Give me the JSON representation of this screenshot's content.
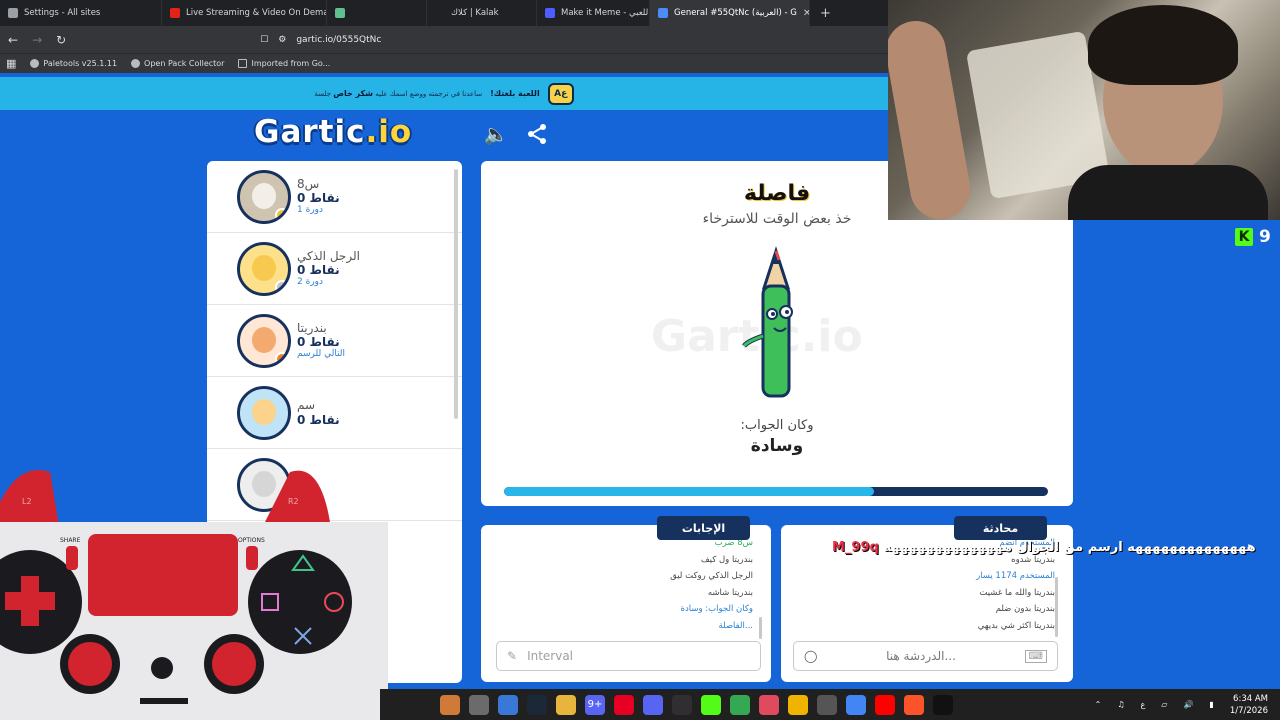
{
  "browser": {
    "tabs": [
      {
        "title": "Settings - All sites",
        "icon": "gear-icon",
        "color": "#9aa0a6"
      },
      {
        "title": "Live Streaming & Video On Demand",
        "icon": "video-icon",
        "color": "#e62117"
      },
      {
        "title": "",
        "icon": "app-icon",
        "color": "#5fbf8f"
      },
      {
        "title": "كلاك | Kalak",
        "icon": "",
        "color": "#202124"
      },
      {
        "title": "Make it Meme - دعوة للعبي",
        "icon": "meme-icon",
        "color": "#4e5dff"
      },
      {
        "title": "General #55QtNc (العربية) - G",
        "icon": "gartic-icon",
        "color": "#4b8cf7"
      }
    ],
    "new_tab": "+",
    "url": "gartic.io/0555QtNc",
    "bookmarks": [
      "Paletools v25.1.11",
      "Open Pack Collector",
      "Imported from Go..."
    ]
  },
  "banner": {
    "prefix": "ساعدنا في ترجمته ووضع اسمك عليه",
    "highlight": "شكر خاص",
    "suffix": "جلسة",
    "cta": "!اللعبة بلغتك"
  },
  "logo": {
    "main": "Gartic",
    "suffix": ".io"
  },
  "players": [
    {
      "name": "س8",
      "score": "0",
      "score_label": "نقاط",
      "turn": "دورة 1",
      "avatar_color": "#cfc4b0",
      "face_color": "#f3efe8",
      "dot_color": "#f2c42a"
    },
    {
      "name": "الرجل الذكي",
      "score": "0",
      "score_label": "نقاط",
      "turn": "دورة 2",
      "avatar_color": "#fde08a",
      "face_color": "#f7c94f",
      "dot_color": "#c5c5c5"
    },
    {
      "name": "بندريتا",
      "score": "0",
      "score_label": "نقاط",
      "turn": "التالي للرسم",
      "avatar_color": "#ffe7d5",
      "face_color": "#f4a96f",
      "dot_color": "#f07f2a"
    },
    {
      "name": "سم",
      "score": "0",
      "score_label": "نقاط",
      "turn": "",
      "avatar_color": "#bfe4f7",
      "face_color": "#fbd38b",
      "dot_color": ""
    },
    {
      "name": "",
      "score": "",
      "score_label": "",
      "turn": "",
      "avatar_color": "#eeeeee",
      "face_color": "#d6d6d6",
      "dot_color": ""
    }
  ],
  "board": {
    "status": "فاصلة",
    "substatus": "خذ بعض الوقت للاسترخاء",
    "watermark": "Gartic.io",
    "answer_label": ":وكان الجواب",
    "answer_word": "وسادة",
    "progress": 0.68
  },
  "answers": {
    "tab": "الإجابات",
    "lines": [
      {
        "text": "س8 ضرب",
        "style": "gr"
      },
      {
        "text": "بندريتا ول كيف",
        "style": ""
      },
      {
        "text": "الرجل الذكي روكت ليق",
        "style": ""
      },
      {
        "text": "بندريتا شاشه",
        "style": ""
      },
      {
        "text": "وكان الجواب: وسادة",
        "style": "hl"
      },
      {
        "text": "الفاصلة...",
        "style": "hl"
      }
    ],
    "input_placeholder": "Interval"
  },
  "chat": {
    "tab": "محادثة",
    "lines": [
      {
        "text": "المستخدم انضم",
        "style": "hl"
      },
      {
        "text": "بندريتا شدوه",
        "style": ""
      },
      {
        "text": "المستخدم 1174 يسار",
        "style": "hl"
      },
      {
        "text": "بندريتا والله ما غشيت",
        "style": ""
      },
      {
        "text": "بندريتا بدون ضلم",
        "style": ""
      },
      {
        "text": "بندريتا اكثر شي بديهي",
        "style": ""
      }
    ],
    "input_placeholder": "الدردشة هنا..."
  },
  "stream_overlay": {
    "k_badge": "K",
    "k_count": "9",
    "chat_user": "M_99q",
    "chat_message": "ههههههههههههههه ارسم من الجوال ههههههههههههههه"
  },
  "controller": {
    "share": "SHARE",
    "options": "OPTIONS",
    "l2": "L2",
    "r2": "R2"
  },
  "taskbar": {
    "icons": [
      {
        "name": "cat-icon",
        "color": "#d07a3a",
        "label": ""
      },
      {
        "name": "files-icon",
        "color": "#6b6b6b",
        "label": ""
      },
      {
        "name": "windows-store-icon",
        "color": "#3a78d8",
        "label": ""
      },
      {
        "name": "steam-icon",
        "color": "#1b2838",
        "label": ""
      },
      {
        "name": "folder-icon",
        "color": "#e7b53b",
        "label": ""
      },
      {
        "name": "discord-icon",
        "color": "#5865f2",
        "label": "9+"
      },
      {
        "name": "pinterest-icon",
        "color": "#e60023",
        "label": ""
      },
      {
        "name": "discord-icon-2",
        "color": "#5865f2",
        "label": ""
      },
      {
        "name": "obs-icon",
        "color": "#302e31",
        "label": ""
      },
      {
        "name": "kick-icon",
        "color": "#53fc18",
        "label": ""
      },
      {
        "name": "chrome-icon",
        "color": "#34a853",
        "label": ""
      },
      {
        "name": "media-icon",
        "color": "#e04a5f",
        "label": ""
      },
      {
        "name": "chrome-canary-icon",
        "color": "#f0b400",
        "label": ""
      },
      {
        "name": "settings-icon",
        "color": "#555",
        "label": ""
      },
      {
        "name": "chrome-icon-2",
        "color": "#4285f4",
        "label": ""
      },
      {
        "name": "youtube-icon",
        "color": "#ff0000",
        "label": ""
      },
      {
        "name": "brave-icon",
        "color": "#fb542b",
        "label": ""
      },
      {
        "name": "capcut-icon",
        "color": "#111",
        "label": ""
      }
    ],
    "lang": "ع",
    "time": "6:34 AM",
    "date": "1/7/2026"
  }
}
